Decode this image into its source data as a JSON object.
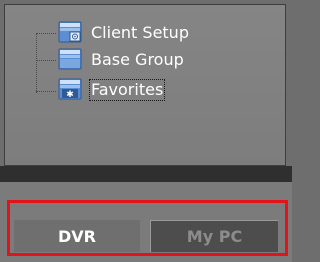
{
  "tree": {
    "items": [
      {
        "label": "Client Setup",
        "icon": "client-setup-icon",
        "selected": false
      },
      {
        "label": "Base Group",
        "icon": "base-group-icon",
        "selected": false
      },
      {
        "label": "Favorites",
        "icon": "favorites-icon",
        "selected": true
      }
    ]
  },
  "tabs": {
    "dvr": {
      "label": "DVR",
      "active": true
    },
    "mypc": {
      "label": "My PC",
      "active": false
    }
  },
  "colors": {
    "highlight_frame": "#e2141a",
    "text": "#ffffff",
    "inactive_text": "#8c8c8c"
  }
}
